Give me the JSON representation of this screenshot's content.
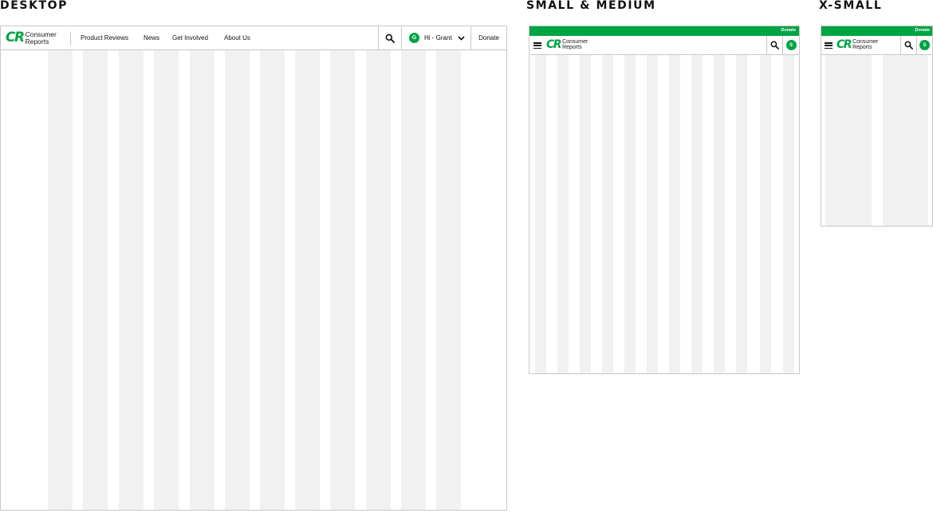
{
  "labels": {
    "desktop": "DESKTOP",
    "small_medium": "SMALL & MEDIUM",
    "xsmall": "X-SMALL"
  },
  "brand": {
    "mark": "CR",
    "line1": "Consumer",
    "line2": "Reports",
    "color": "#00a443"
  },
  "desktop_nav": {
    "links": [
      "Product Reviews",
      "News",
      "Get Involved",
      "About Us"
    ],
    "user_initial": "G",
    "greeting": "Hi - Grant",
    "donate": "Donate",
    "icons": [
      "search-icon",
      "chevron-down-icon"
    ]
  },
  "small_nav": {
    "donate": "Donate",
    "user_initial": "S",
    "icons": [
      "hamburger-icon",
      "search-icon"
    ]
  },
  "xsmall_nav": {
    "donate": "Donate",
    "user_initial": "S",
    "icons": [
      "hamburger-icon",
      "search-icon"
    ]
  },
  "colors": {
    "accent": "#00a443",
    "grid_column": "#f1f1f1",
    "border": "#c8c8c8"
  }
}
